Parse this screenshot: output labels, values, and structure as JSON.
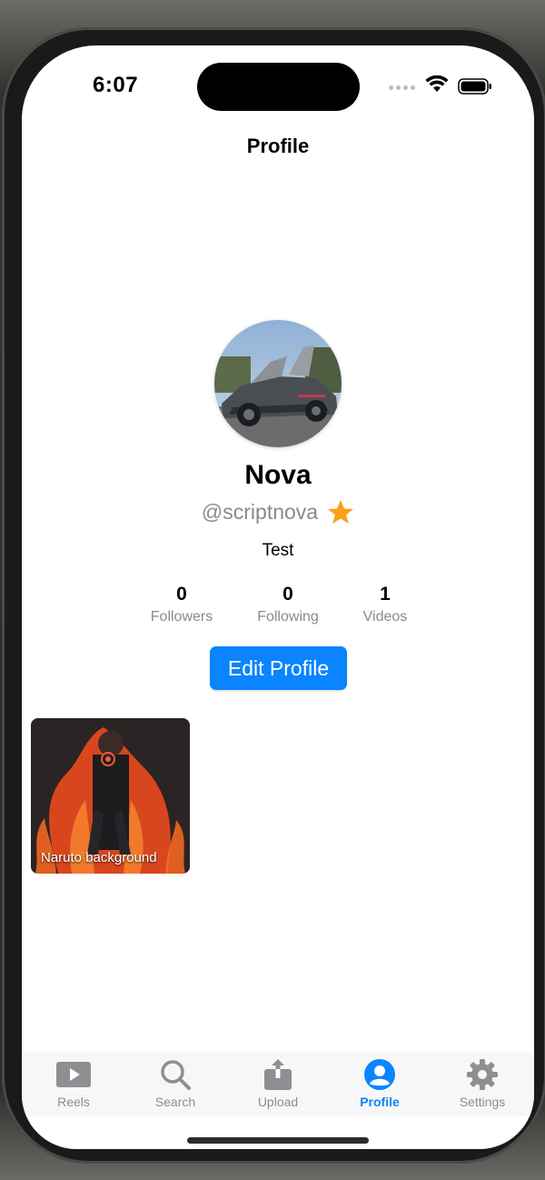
{
  "status_bar": {
    "time": "6:07"
  },
  "nav": {
    "title": "Profile"
  },
  "profile": {
    "name": "Nova",
    "handle": "@scriptnova",
    "bio": "Test",
    "badge_icon": "star-icon",
    "badge_color": "#f7a21b"
  },
  "stats": [
    {
      "value": "0",
      "label": "Followers"
    },
    {
      "value": "0",
      "label": "Following"
    },
    {
      "value": "1",
      "label": "Videos"
    }
  ],
  "edit_button": {
    "label": "Edit Profile",
    "color": "#0a84ff"
  },
  "videos": [
    {
      "caption": "Naruto background"
    }
  ],
  "tabbar": {
    "active_color": "#0a84ff",
    "tabs": [
      {
        "label": "Reels",
        "icon": "play-icon"
      },
      {
        "label": "Search",
        "icon": "search-icon"
      },
      {
        "label": "Upload",
        "icon": "upload-icon"
      },
      {
        "label": "Profile",
        "icon": "person-icon",
        "active": true
      },
      {
        "label": "Settings",
        "icon": "gear-icon"
      }
    ]
  }
}
